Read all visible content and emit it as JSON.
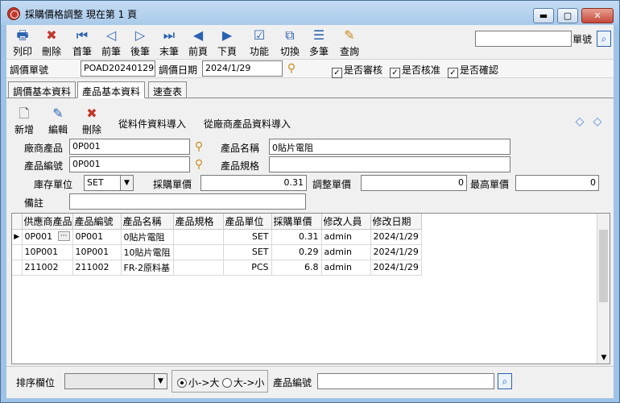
{
  "window": {
    "title": "採購價格調整  現在第 1 頁",
    "min_label": "▬",
    "max_label": "▢",
    "close_label": "✕"
  },
  "toolbar": {
    "buttons": [
      {
        "label": "列印",
        "icon": "print-icon",
        "glyph": "🖶"
      },
      {
        "label": "刪除",
        "icon": "delete-icon",
        "glyph": "✖"
      },
      {
        "label": "首筆",
        "icon": "first-record-icon",
        "glyph": "⏮"
      },
      {
        "label": "前筆",
        "icon": "prev-record-icon",
        "glyph": "◁"
      },
      {
        "label": "後筆",
        "icon": "next-record-icon",
        "glyph": "▷"
      },
      {
        "label": "末筆",
        "icon": "last-record-icon",
        "glyph": "⏭"
      },
      {
        "label": "前頁",
        "icon": "prev-page-icon",
        "glyph": "◀"
      },
      {
        "label": "下頁",
        "icon": "next-page-icon",
        "glyph": "▶"
      },
      {
        "label": "功能",
        "icon": "function-icon",
        "glyph": "☑"
      },
      {
        "label": "切換",
        "icon": "switch-icon",
        "glyph": "⧉"
      },
      {
        "label": "多筆",
        "icon": "multi-record-icon",
        "glyph": "☰"
      },
      {
        "label": "查詢",
        "icon": "query-icon",
        "glyph": "✎"
      }
    ],
    "search_value": "",
    "search_label": "單號"
  },
  "header": {
    "doc_no_label": "調價單號",
    "doc_no_value": "POAD20240129001",
    "date_label": "調價日期",
    "date_value": "2024/1/29",
    "checks": [
      {
        "label": "是否審核",
        "checked": true
      },
      {
        "label": "是否核准",
        "checked": true
      },
      {
        "label": "是否確認",
        "checked": true
      }
    ]
  },
  "tabs": [
    "調價基本資料",
    "產品基本資料",
    "速查表"
  ],
  "subtoolbar": {
    "add_label": "新增",
    "edit_label": "編輯",
    "delete_label": "刪除",
    "import_material_label": "從料件資料導入",
    "import_vendor_label": "從廠商產品資料導入"
  },
  "detail": {
    "vendor_product_label": "廠商產品",
    "vendor_product_value": "0P001",
    "product_name_label": "產品名稱",
    "product_name_value": "0貼片電阻",
    "product_no_label": "產品編號",
    "product_no_value": "0P001",
    "product_spec_label": "產品規格",
    "product_spec_value": "",
    "stock_unit_label": "庫存單位",
    "stock_unit_value": "SET",
    "purchase_price_label": "採購單價",
    "purchase_price_value": "0.31",
    "adjust_price_label": "調整單價",
    "adjust_price_value": "0",
    "max_price_label": "最高單價",
    "max_price_value": "0",
    "remark_label": "備註",
    "remark_value": ""
  },
  "grid": {
    "columns": [
      "供應商產品",
      "產品編號",
      "產品名稱",
      "產品規格",
      "產品單位",
      "採購單價",
      "修改人員",
      "修改日期"
    ],
    "rows": [
      {
        "vendor_product": "0P001",
        "product_no": "0P001",
        "name": "0貼片電阻",
        "spec": "",
        "unit": "SET",
        "price": "0.31",
        "editor": "admin",
        "date": "2024/1/29"
      },
      {
        "vendor_product": "10P001",
        "product_no": "10P001",
        "name": "10貼片電阻",
        "spec": "",
        "unit": "SET",
        "price": "0.29",
        "editor": "admin",
        "date": "2024/1/29"
      },
      {
        "vendor_product": "211002",
        "product_no": "211002",
        "name": "FR-2原料基",
        "spec": "",
        "unit": "PCS",
        "price": "6.8",
        "editor": "admin",
        "date": "2024/1/29"
      }
    ],
    "cell_button_label": "···"
  },
  "bottom": {
    "sort_label": "排序欄位",
    "sort_value": "",
    "asc_label": "小->大",
    "desc_label": "大->小",
    "product_no_label": "產品編號",
    "product_no_value": ""
  }
}
